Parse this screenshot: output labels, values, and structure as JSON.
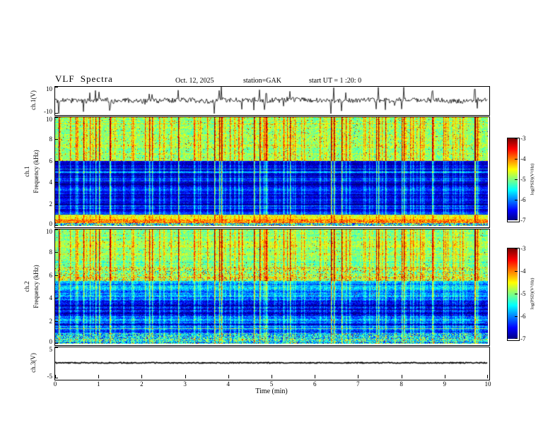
{
  "header": {
    "title": "VLF Spectra",
    "date": "Oct. 12, 2025",
    "station": "station=GAK",
    "start_ut": "start UT =  1 :20: 0"
  },
  "axes": {
    "x": {
      "label": "Time (min)",
      "ticks": [
        "0",
        "1",
        "2",
        "3",
        "4",
        "5",
        "6",
        "7",
        "8",
        "9",
        "10"
      ]
    },
    "wave1_y": {
      "label": "ch.1(V)",
      "ticks": [
        "10",
        "-10"
      ]
    },
    "spec1_y": {
      "label_channel": "ch.1",
      "label": "Frequency (kHz)",
      "ticks": [
        "10",
        "8",
        "6",
        "4",
        "2",
        "0"
      ]
    },
    "spec2_y": {
      "label_channel": "ch.2",
      "label": "Frequency (kHz)",
      "ticks": [
        "10",
        "8",
        "6",
        "4",
        "2",
        "0"
      ]
    },
    "wave3_y": {
      "label": "ch.3(V)",
      "ticks": [
        "5",
        "-5"
      ]
    },
    "colorbar": {
      "label": "log(PSD)(V²/Hz)",
      "ticks": [
        "-3",
        "-4",
        "-5",
        "-6",
        "-7"
      ]
    }
  },
  "chart_data": [
    {
      "id": "ch1-waveform",
      "type": "line",
      "ylabel": "ch.1(V)",
      "xlabel": "Time (min)",
      "xlim": [
        0,
        10
      ],
      "ylim": [
        -10,
        10
      ],
      "yticks": [
        10,
        -10
      ],
      "noise_amplitude": 1.8,
      "spike_amplitude": 9,
      "description": "Continuous broadband VLF noise of about +/-2 V around 0 V for the full 10 minutes, with frequent impulsive sferic spikes reaching about +/-9 V that line up with the vertical streaks in the spectrograms below"
    },
    {
      "id": "ch1-spectrogram",
      "type": "heatmap",
      "channel": "ch.1",
      "ylabel": "Frequency (kHz)",
      "xlim": [
        0,
        10
      ],
      "ylim": [
        0,
        10
      ],
      "zlim": [
        -7,
        -3
      ],
      "yticks": [
        10,
        8,
        6,
        4,
        2,
        0
      ],
      "colormap": "jet",
      "colorbar_label": "log(PSD)(V²/Hz)",
      "streak_probability": 0.06,
      "bands": [
        {
          "f0": 6.0,
          "f1": 10.01,
          "base": 0.5,
          "noise": 0.11,
          "streak": 1.0,
          "speckle": 0.02,
          "rowmod": 0.5
        },
        {
          "f0": 1.05,
          "f1": 6.0,
          "base": 0.1,
          "noise": 0.07,
          "streak": 0.8,
          "speckle": 0.0,
          "rowmod": 1.5
        },
        {
          "f0": 0.6,
          "f1": 1.05,
          "base": 0.55,
          "noise": 0.1,
          "streak": 0.45,
          "speckle": 0.01,
          "rowmod": 0.6
        },
        {
          "f0": 0.25,
          "f1": 0.6,
          "base": 0.72,
          "noise": 0.14,
          "streak": 0.25,
          "speckle": 0.04,
          "rowmod": 0.5
        },
        {
          "f0": 0.0,
          "f1": 0.25,
          "base": 0.4,
          "noise": 0.3,
          "streak": 0.2,
          "speckle": 0.03,
          "rowmod": 0.8
        }
      ],
      "description": "Dense vertical sferic striations across all frequencies; high PSD (-4.5 to -3) shown green/yellow with red bursts above ~6 kHz, low PSD (-7 to -6) dark blue from ~1-6 kHz crossed by cyan streaks and faint horizontal interference lines, and an enhanced yellow-green band below ~1 kHz"
    },
    {
      "id": "ch2-spectrogram",
      "type": "heatmap",
      "channel": "ch.2",
      "ylabel": "Frequency (kHz)",
      "xlim": [
        0,
        10
      ],
      "ylim": [
        0,
        10
      ],
      "zlim": [
        -7,
        -3
      ],
      "yticks": [
        10,
        8,
        6,
        4,
        2,
        0
      ],
      "colormap": "jet",
      "colorbar_label": "log(PSD)(V²/Hz)",
      "streak_probability": 0.06,
      "bands": [
        {
          "f0": 6.7,
          "f1": 10.01,
          "base": 0.48,
          "noise": 0.1,
          "streak": 0.95,
          "speckle": 0.012,
          "rowmod": 0.6
        },
        {
          "f0": 5.5,
          "f1": 6.7,
          "base": 0.52,
          "noise": 0.16,
          "streak": 0.85,
          "speckle": 0.06,
          "rowmod": 0.7
        },
        {
          "f0": 4.1,
          "f1": 5.5,
          "base": 0.27,
          "noise": 0.1,
          "streak": 0.75,
          "speckle": 0.004,
          "rowmod": 1.4
        },
        {
          "f0": 0.9,
          "f1": 4.1,
          "base": 0.2,
          "noise": 0.1,
          "streak": 0.75,
          "speckle": 0.001,
          "rowmod": 1.7
        },
        {
          "f0": 0.0,
          "f1": 0.9,
          "base": 0.36,
          "noise": 0.22,
          "streak": 0.55,
          "speckle": 0.02,
          "rowmod": 1.1
        }
      ],
      "description": "Green band above ~6.7 kHz with sferic streaks, a speckled orange/red enhancement band near 5.5-6.7 kHz, and blue low-PSD region below ~5.5 kHz with many cyan horizontal interference lines and vertical sferic streaks"
    },
    {
      "id": "ch3-waveform",
      "type": "line",
      "ylabel": "ch.3(V)",
      "xlabel": "Time (min)",
      "xlim": [
        0,
        10
      ],
      "ylim": [
        -5,
        5
      ],
      "yticks": [
        5,
        -5
      ],
      "value": 0,
      "description": "Flat dark trace at approximately 0 V for the entire 10 minute interval (channel constant / no signal)"
    }
  ]
}
